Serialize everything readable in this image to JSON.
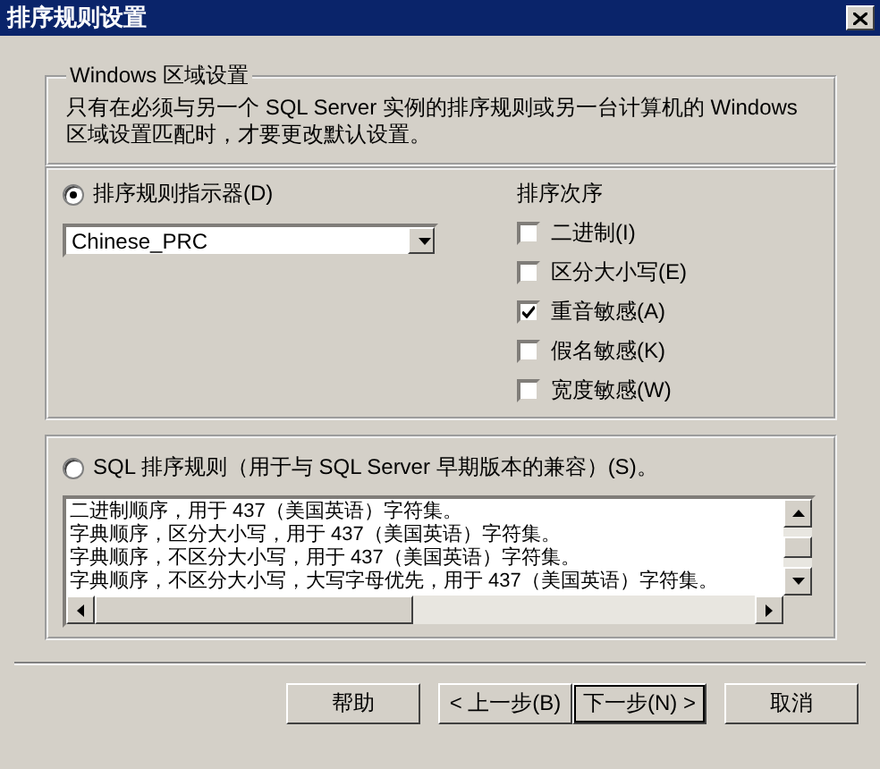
{
  "window": {
    "title": "排序规则设置"
  },
  "windows_locale": {
    "legend": "Windows 区域设置",
    "description": "只有在必须与另一个 SQL Server 实例的排序规则或另一台计算机的 Windows 区域设置匹配时，才要更改默认设置。"
  },
  "collation_designator": {
    "label": "排序规则指示器(D)",
    "selected": true,
    "value": "Chinese_PRC"
  },
  "sort_order": {
    "title": "排序次序",
    "options": [
      {
        "label": "二进制(I)",
        "checked": false
      },
      {
        "label": "区分大小写(E)",
        "checked": false
      },
      {
        "label": "重音敏感(A)",
        "checked": true
      },
      {
        "label": "假名敏感(K)",
        "checked": false
      },
      {
        "label": "宽度敏感(W)",
        "checked": false
      }
    ]
  },
  "sql_collation": {
    "label": "SQL 排序规则（用于与 SQL Server 早期版本的兼容）(S)。",
    "selected": false,
    "rows": [
      "二进制顺序，用于 437（美国英语）字符集。",
      "字典顺序，区分大小写，用于 437（美国英语）字符集。",
      "字典顺序，不区分大小写，用于 437（美国英语）字符集。",
      "字典顺序，不区分大小写，大写字母优先，用于 437（美国英语）字符集。"
    ]
  },
  "buttons": [
    {
      "label": "帮助",
      "default": false
    },
    {
      "label": "< 上一步(B)",
      "default": false
    },
    {
      "label": "下一步(N) >",
      "default": true
    },
    {
      "label": "取消",
      "default": false
    }
  ]
}
